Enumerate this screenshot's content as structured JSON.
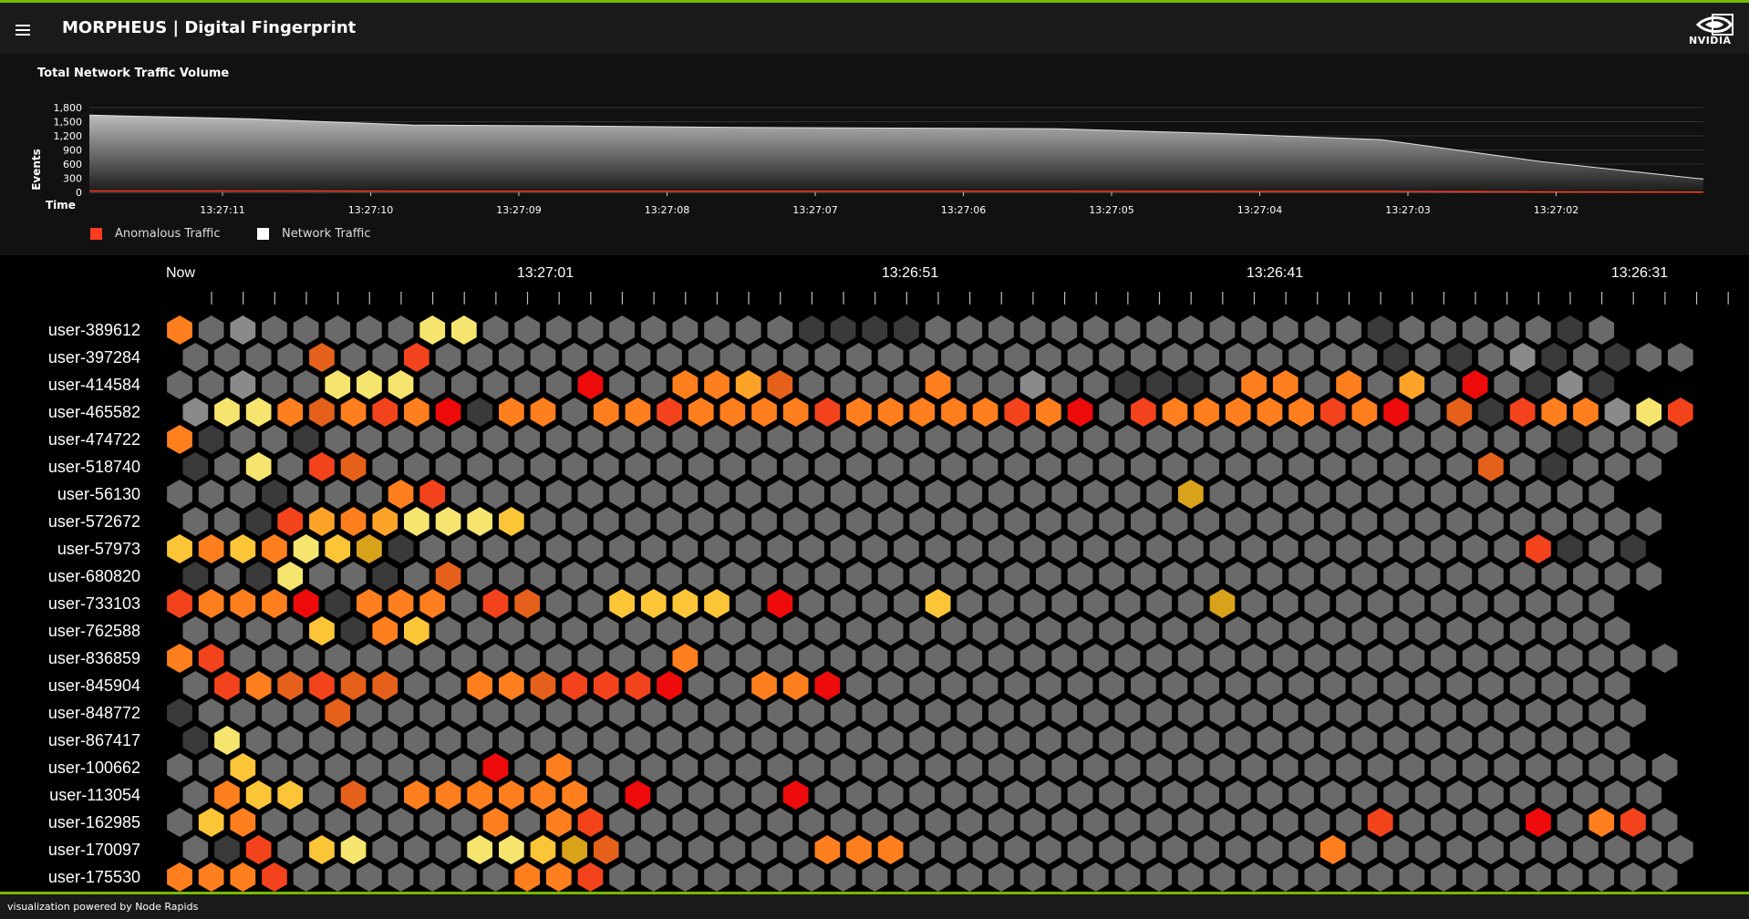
{
  "header": {
    "title": "MORPHEUS | Digital Fingerprint",
    "logo_text": "NVIDIA"
  },
  "colors": {
    "accent": "#76b900",
    "anomalous": "#ff3b1f",
    "network": "#ffffff",
    "bin_palette": [
      "#1e1e1e",
      "#3a3a3a",
      "#6a6a6a",
      "#8a8a8a",
      "#f5e46e",
      "#fcc538",
      "#d9a21b",
      "#c8c226",
      "#fda428",
      "#ff7f1e",
      "#e5611b",
      "#f3431c",
      "#ee0b0b"
    ]
  },
  "chart_data": {
    "type": "area",
    "title": "Total Network Traffic Volume",
    "ylabel": "Events",
    "xlabel": "Time",
    "ylim": [
      0,
      1800
    ],
    "yticks": [
      "1,800",
      "1,500",
      "1,200",
      "900",
      "600",
      "300",
      "0"
    ],
    "grid": true,
    "legend_position": "bottom-left",
    "xticks": [
      "13:27:11",
      "13:27:10",
      "13:27:09",
      "13:27:08",
      "13:27:07",
      "13:27:06",
      "13:27:05",
      "13:27:04",
      "13:27:03",
      "13:27:02"
    ],
    "series": [
      {
        "name": "Network Traffic",
        "values": [
          1640,
          1560,
          1430,
          1410,
          1380,
          1365,
          1350,
          1250,
          1120,
          650,
          280
        ]
      },
      {
        "name": "Anomalous Traffic",
        "values": [
          30,
          30,
          25,
          25,
          25,
          25,
          25,
          20,
          20,
          10,
          5
        ]
      }
    ]
  },
  "legend": {
    "anomalous_label": "Anomalous Traffic",
    "network_label": "Network Traffic"
  },
  "grid": {
    "time_labels": [
      "Now",
      "13:27:01",
      "13:26:51",
      "13:26:41",
      "13:26:31"
    ],
    "users": [
      {
        "name": "user-389612",
        "bins": "9232222244222222222211112222222222222212222212"
      },
      {
        "name": "user-397284",
        "bins": "2222A22B2222222222222222222222222222221212312122"
      },
      {
        "name": "user-414584",
        "bins": "2232244422222C22998A222292232211129929282C2131"
      },
      {
        "name": "user-465582",
        "bins": "3449A9B9C199299B9999B99999B9C2B99999B9C2A1B9934B91"
      },
      {
        "name": "user-474722",
        "bins": "9122122222222222222222222222222222222222222212222"
      },
      {
        "name": "user-518740",
        "bins": "1242BA22222222222222222222222222222222222A21222"
      },
      {
        "name": "user-56130",
        "bins": "22212229B2222222222222222222222262222222222222"
      },
      {
        "name": "user-572672",
        "bins": "221B8984445222222222222222222222222222222222222"
      },
      {
        "name": "user-57973",
        "bins": "5959456122222222222222222222222222222222222B121"
      },
      {
        "name": "user-680820",
        "bins": "12142212A22222222222222222222222222222222222222"
      },
      {
        "name": "user-733103",
        "bins": "B999C19992BA2255552C22225222222226222222222222"
      },
      {
        "name": "user-762588",
        "bins": "2222519522222222222222222222222222222222222222"
      },
      {
        "name": "user-836859",
        "bins": "9B2222222222222292222222222222222222222222222222"
      },
      {
        "name": "user-845904",
        "bins": "2B9ABAA2299ABBBC2299C2222222222222222222222222"
      },
      {
        "name": "user-848772",
        "bins": "12222A22222222222222222222222222222222222222222"
      },
      {
        "name": "user-867417",
        "bins": "1422222222222222222222222222222222222222222222"
      },
      {
        "name": "user-100662",
        "bins": "2252222222C2922222222222222222222222222222222222"
      },
      {
        "name": "user-113054",
        "bins": "29552A29999992C2222C222222222222222222222222222"
      },
      {
        "name": "user-162985",
        "bins": "2592222222929B222222222222222222222222B2222C29B22"
      },
      {
        "name": "user-170097",
        "bins": "21B2542224456A222222999222222222222292222222222222"
      },
      {
        "name": "user-175530",
        "bins": "999B222222299B22222222222222222222222222222222222"
      }
    ]
  },
  "footer": {
    "text": "visualization powered by Node Rapids"
  }
}
